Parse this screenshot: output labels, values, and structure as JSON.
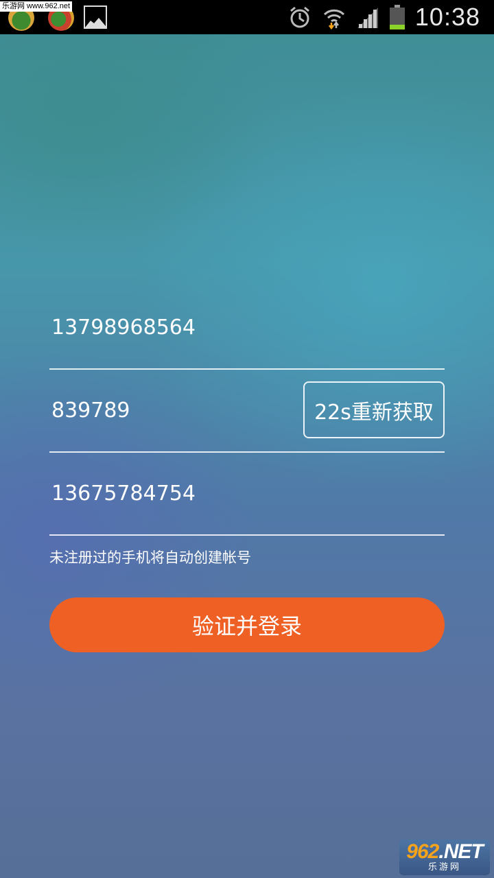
{
  "status_bar": {
    "watermark": "乐游网 www.962.net",
    "time": "10:38",
    "icons": [
      "app-icon",
      "app-icon",
      "gallery-icon",
      "alarm-icon",
      "wifi-icon",
      "signal-icon",
      "battery-icon"
    ]
  },
  "form": {
    "phone": {
      "value": "13798968564"
    },
    "code": {
      "value": "839789",
      "resend_label": "22s重新获取"
    },
    "invite": {
      "value": "13675784754"
    },
    "hint": "未注册过的手机将自动创建帐号",
    "submit_label": "验证并登录"
  },
  "watermark_bottom": {
    "brand_number": "962",
    "brand_suffix": ".NET",
    "sub": "乐游网"
  },
  "colors": {
    "accent": "#ef6025",
    "underline": "#ffffff",
    "status_bar": "#000000"
  }
}
